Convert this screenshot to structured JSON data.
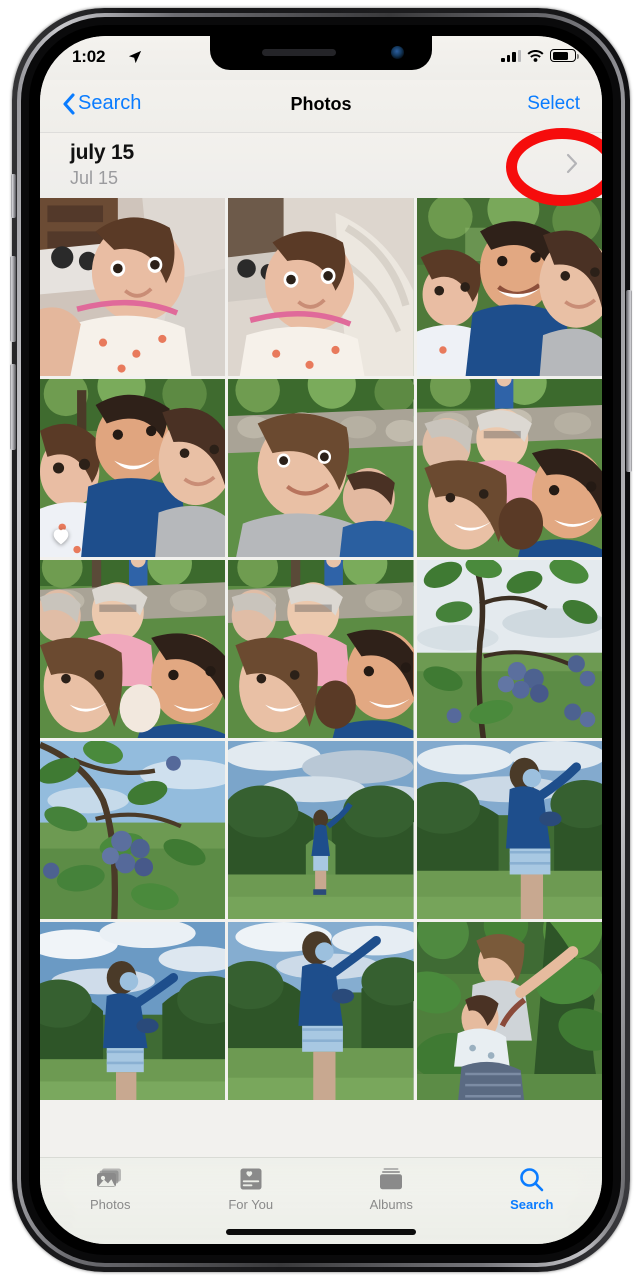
{
  "status_bar": {
    "time": "1:02",
    "location_icon": "location-arrow-icon",
    "cellular_icon": "cellular-signal-icon",
    "cellular_bars_filled": 3,
    "cellular_bars_total": 4,
    "wifi_icon": "wifi-icon",
    "battery_icon": "battery-icon",
    "battery_level_percent": 72
  },
  "nav_bar": {
    "back_label": "Search",
    "back_icon": "chevron-left-icon",
    "title": "Photos",
    "select_label": "Select"
  },
  "date_header": {
    "title": "july 15",
    "subtitle": "Jul 15",
    "chevron_icon": "chevron-right-icon"
  },
  "annotation": {
    "shape": "ellipse-outline",
    "color": "#f60c0c",
    "target": "Select"
  },
  "grid": {
    "columns": 3,
    "photos": [
      {
        "id": "p1",
        "alt": "Baby lying on bed looking up, dresser behind",
        "favorite": false
      },
      {
        "id": "p2",
        "alt": "Baby lying on bed next to white pillow",
        "favorite": false
      },
      {
        "id": "p3",
        "alt": "Family selfie outdoors with baby, man and woman",
        "favorite": false
      },
      {
        "id": "p4",
        "alt": "Family selfie with baby in yard",
        "favorite": true
      },
      {
        "id": "p5",
        "alt": "Couple selfie with baby in front of stone wall",
        "favorite": false
      },
      {
        "id": "p6",
        "alt": "Group selfie with grandparents and baby",
        "favorite": false
      },
      {
        "id": "p7",
        "alt": "Group photo with grandparents, child on wall",
        "favorite": false
      },
      {
        "id": "p8",
        "alt": "Group selfie with grandparents and child",
        "favorite": false
      },
      {
        "id": "p9",
        "alt": "Blueberry bush with berries against sky",
        "favorite": false
      },
      {
        "id": "p10",
        "alt": "Blueberry branch close up with green leaves",
        "favorite": false
      },
      {
        "id": "p11",
        "alt": "Person picking berries in orchard row at dusk",
        "favorite": false
      },
      {
        "id": "p12",
        "alt": "Person in blue jacket reaching for berries",
        "favorite": false
      },
      {
        "id": "p13",
        "alt": "Person picking berries with blue sky and clouds",
        "favorite": false
      },
      {
        "id": "p14",
        "alt": "Person holding bowl picking berries in field",
        "favorite": false
      },
      {
        "id": "p15",
        "alt": "Woman holding baby picking berries from bush",
        "favorite": false
      }
    ]
  },
  "tab_bar": {
    "tabs": [
      {
        "label": "Photos",
        "icon": "photos-icon",
        "active": false
      },
      {
        "label": "For You",
        "icon": "for-you-icon",
        "active": false
      },
      {
        "label": "Albums",
        "icon": "albums-icon",
        "active": false
      },
      {
        "label": "Search",
        "icon": "search-icon",
        "active": true
      }
    ],
    "active_color": "#0a7cff",
    "inactive_color": "#8a8a8a"
  }
}
